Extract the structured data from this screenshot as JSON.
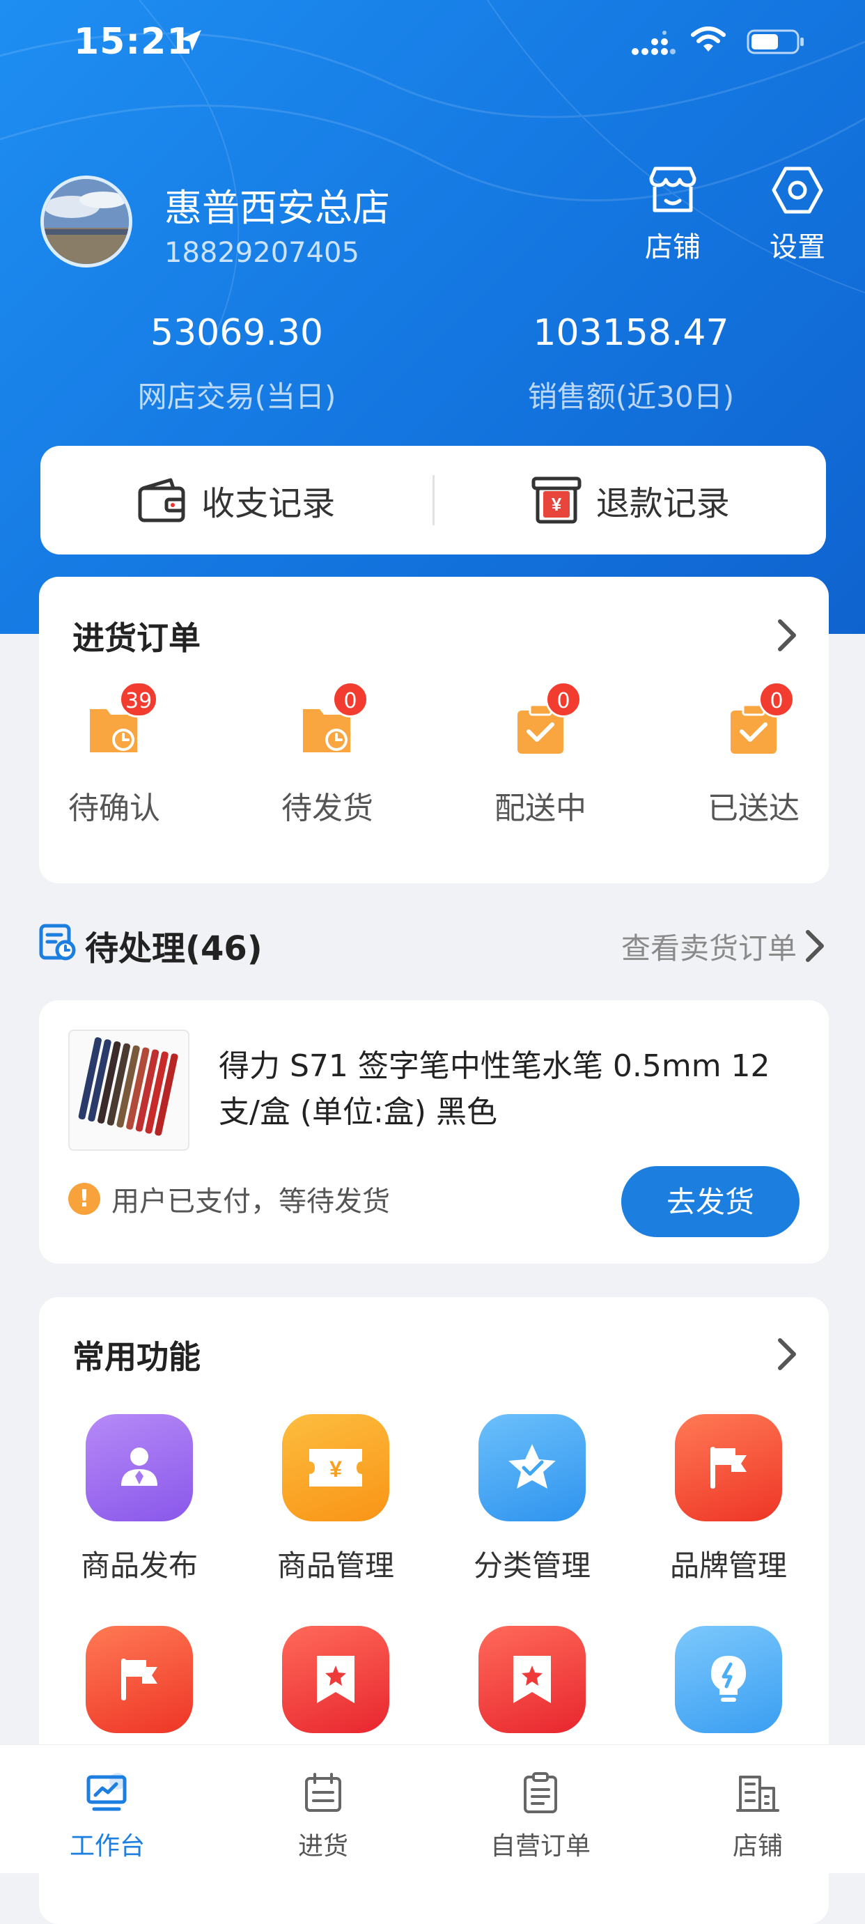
{
  "status_bar": {
    "time": "15:21"
  },
  "store": {
    "name": "惠普西安总店",
    "phone": "18829207405"
  },
  "top_actions": [
    {
      "label": "店铺",
      "icon": "shop-icon"
    },
    {
      "label": "设置",
      "icon": "settings-hexagon-icon"
    }
  ],
  "stats": [
    {
      "value": "53069.30",
      "label": "网店交易(当日)"
    },
    {
      "value": "103158.47",
      "label": "销售额(近30日)"
    }
  ],
  "records": [
    {
      "label": "收支记录",
      "icon": "wallet-icon"
    },
    {
      "label": "退款记录",
      "icon": "refund-icon"
    }
  ],
  "purchase_orders": {
    "title": "进货订单",
    "statuses": [
      {
        "label": "待确认",
        "count": "39"
      },
      {
        "label": "待发货",
        "count": "0"
      },
      {
        "label": "配送中",
        "count": "0"
      },
      {
        "label": "已送达",
        "count": "0"
      }
    ]
  },
  "pending": {
    "title": "待处理(46)",
    "link": "查看卖货订单",
    "item": {
      "name": "得力 S71 签字笔中性笔水笔 0.5mm 12支/盒 (单位:盒) 黑色",
      "status": "用户已支付，等待发货",
      "action": "去发货"
    }
  },
  "functions": {
    "title": "常用功能",
    "items": [
      {
        "label": "商品发布",
        "icon": "product-publish-icon",
        "color": "#9b6bf0"
      },
      {
        "label": "商品管理",
        "icon": "ticket-yen-icon",
        "color": "#fba21c"
      },
      {
        "label": "分类管理",
        "icon": "star-check-icon",
        "color": "#3fa6f5"
      },
      {
        "label": "品牌管理",
        "icon": "flag-icon",
        "color": "#f5452f"
      },
      {
        "label": "",
        "icon": "flag-icon",
        "color": "#f5452f"
      },
      {
        "label": "",
        "icon": "bookmark-star-icon",
        "color": "#f23a3a"
      },
      {
        "label": "",
        "icon": "bookmark-star-icon",
        "color": "#f23a3a"
      },
      {
        "label": "",
        "icon": "lightbulb-icon",
        "color": "#4aaef7"
      }
    ]
  },
  "tabs": [
    {
      "label": "工作台",
      "icon": "dashboard-icon",
      "active": true
    },
    {
      "label": "进货",
      "icon": "calendar-list-icon"
    },
    {
      "label": "自营订单",
      "icon": "clipboard-icon"
    },
    {
      "label": "店铺",
      "icon": "building-icon"
    }
  ],
  "colors": {
    "primary": "#1c7fe0",
    "badge": "#f23c2f",
    "warning": "#f7a23a",
    "order_icon": "#f9a640"
  }
}
